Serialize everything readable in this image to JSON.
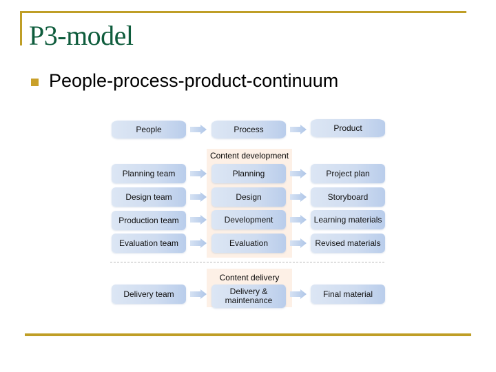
{
  "slide": {
    "title": "P3-model",
    "bullet": "People-process-product-continuum",
    "accent_color": "#BF9E26",
    "title_color": "#0E5C3C"
  },
  "diagram": {
    "headers": [
      "People",
      "Process",
      "Product"
    ],
    "sections": {
      "content_development": "Content development",
      "content_delivery": "Content delivery"
    },
    "rows": [
      {
        "people": "Planning team",
        "process": "Planning",
        "product": "Project plan"
      },
      {
        "people": "Design team",
        "process": "Design",
        "product": "Storyboard"
      },
      {
        "people": "Production team",
        "process": "Development",
        "product": "Learning materials"
      },
      {
        "people": "Evaluation team",
        "process": "Evaluation",
        "product": "Revised materials"
      },
      {
        "people": "Delivery team",
        "process": "Delivery & maintenance",
        "product": "Final material"
      }
    ],
    "box_color": "#CFDCF0",
    "section_bg_color": "#FDF0E6"
  }
}
